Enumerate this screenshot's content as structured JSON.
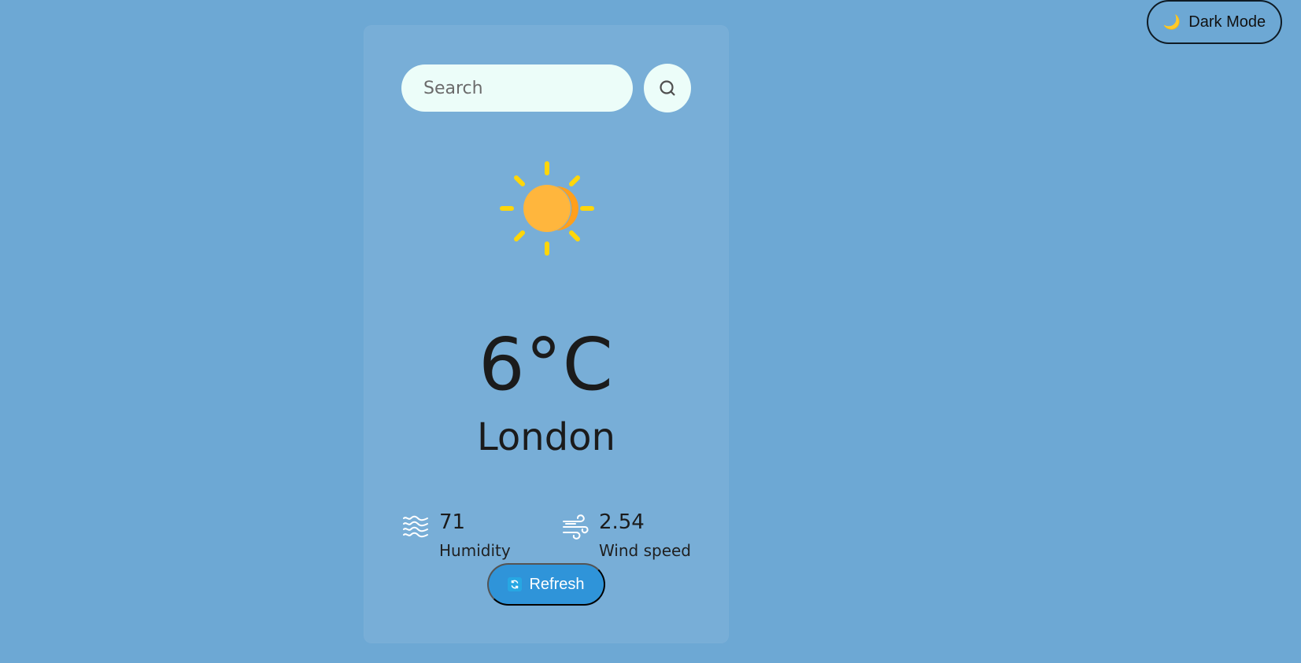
{
  "header": {
    "dark_mode_label": "Dark Mode",
    "dark_mode_icon": "moon-icon"
  },
  "search": {
    "placeholder": "Search",
    "icon": "search-icon"
  },
  "weather": {
    "icon": "sun-icon",
    "temperature": "6°C",
    "city": "London"
  },
  "details": {
    "humidity": {
      "value": "71",
      "label": "Humidity",
      "icon": "humidity-icon"
    },
    "wind_speed": {
      "value": "2.54",
      "label": "Wind speed",
      "icon": "wind-icon"
    }
  },
  "actions": {
    "refresh_label": "Refresh",
    "refresh_icon": "refresh-icon"
  },
  "colors": {
    "background": "#6da8d4",
    "card": "#7bb1da",
    "search": "#ecfdf9",
    "refresh": "#2f94d9",
    "text": "#1b1b1b",
    "sun": "#ffb63d"
  }
}
